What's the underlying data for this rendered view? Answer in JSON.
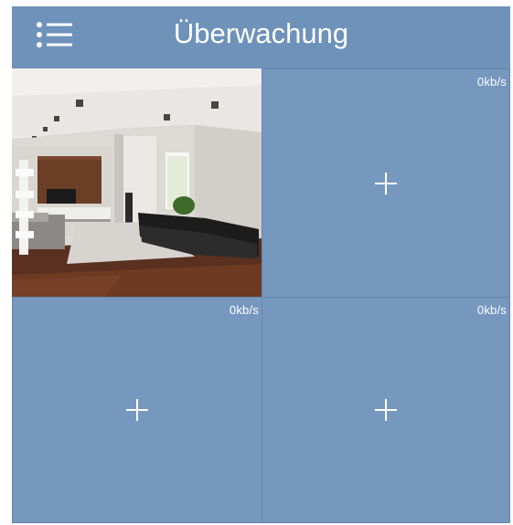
{
  "header": {
    "title": "Überwachung",
    "menu_icon": "hamburger-menu-icon"
  },
  "channels": [
    {
      "rate": "",
      "state": "live-preview",
      "icon": ""
    },
    {
      "rate": "0kb/s",
      "state": "empty",
      "icon": "plus-icon"
    },
    {
      "rate": "0kb/s",
      "state": "empty",
      "icon": "plus-icon"
    },
    {
      "rate": "0kb/s",
      "state": "empty",
      "icon": "plus-icon"
    }
  ],
  "colors": {
    "header_bg": "#6e92ba",
    "cell_bg": "#7698bf",
    "cell_border": "#6685a8",
    "text": "#ffffff"
  }
}
